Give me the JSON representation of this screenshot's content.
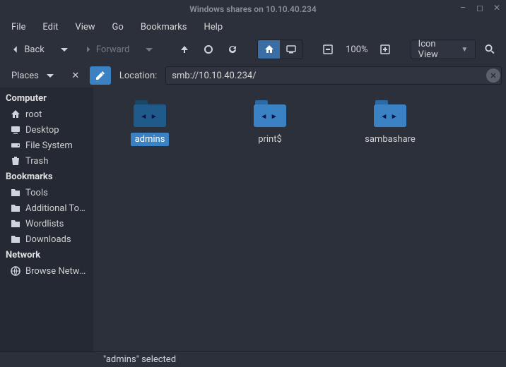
{
  "window": {
    "title": "Windows shares on 10.10.40.234"
  },
  "menubar": [
    "File",
    "Edit",
    "View",
    "Go",
    "Bookmarks",
    "Help"
  ],
  "toolbar": {
    "back": "Back",
    "forward": "Forward",
    "zoom_text": "100%",
    "view_label": "Icon View"
  },
  "location": {
    "places_label": "Places",
    "label": "Location:",
    "value": "smb://10.10.40.234/"
  },
  "sidebar": {
    "groups": [
      {
        "title": "Computer",
        "items": [
          {
            "icon": "home",
            "label": "root"
          },
          {
            "icon": "desktop",
            "label": "Desktop"
          },
          {
            "icon": "drive",
            "label": "File System"
          },
          {
            "icon": "trash",
            "label": "Trash"
          }
        ]
      },
      {
        "title": "Bookmarks",
        "items": [
          {
            "icon": "folder",
            "label": "Tools"
          },
          {
            "icon": "folder",
            "label": "Additional Tools and Drivers"
          },
          {
            "icon": "folder",
            "label": "Wordlists"
          },
          {
            "icon": "folder",
            "label": "Downloads"
          }
        ]
      },
      {
        "title": "Network",
        "items": [
          {
            "icon": "network",
            "label": "Browse Network"
          }
        ]
      }
    ]
  },
  "content": {
    "items": [
      {
        "name": "admins",
        "selected": true
      },
      {
        "name": "print$",
        "selected": false
      },
      {
        "name": "sambashare",
        "selected": false
      }
    ]
  },
  "statusbar": {
    "text": "\"admins\" selected"
  },
  "colors": {
    "folder": "#3b82c4",
    "folder_tab": "#2a6aa6",
    "accent": "#3b82c4"
  }
}
